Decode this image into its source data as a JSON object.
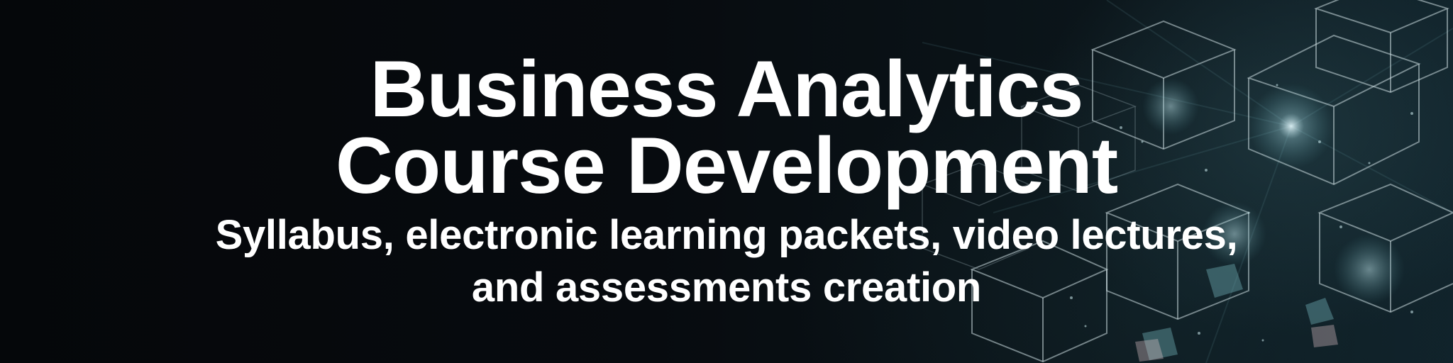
{
  "banner": {
    "title_line1": "Business Analytics",
    "title_line2": "Course Development",
    "subtitle_line1": "Syllabus, electronic learning packets, video lectures,",
    "subtitle_line2": "and assessments creation"
  },
  "colors": {
    "background": "#05080b",
    "accent_glow": "#2e5a63",
    "text": "#ffffff"
  }
}
